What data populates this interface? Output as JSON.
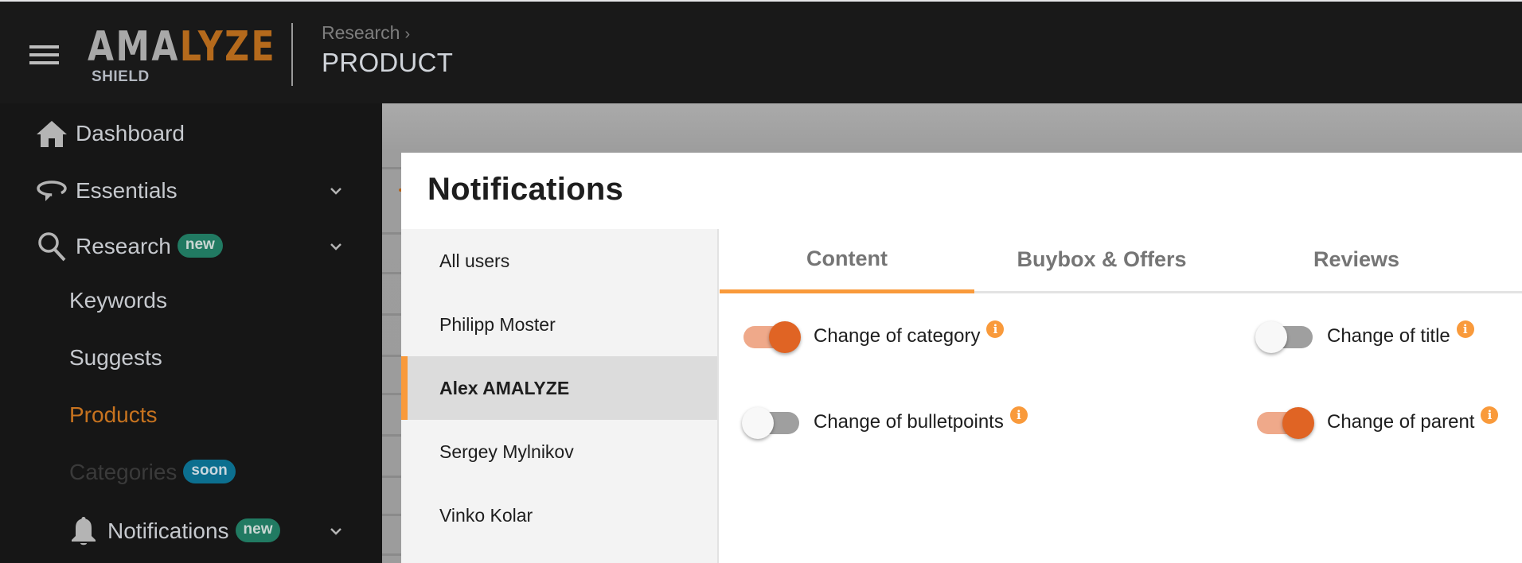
{
  "header": {
    "logo_primary": "AMA",
    "logo_accent": "LYZE",
    "logo_sub": "SHIELD",
    "breadcrumb_parent": "Research",
    "breadcrumb_sep": "›",
    "page_title": "PRODUCT"
  },
  "sidebar": {
    "items": [
      {
        "label": "Dashboard",
        "icon": "home-icon"
      },
      {
        "label": "Essentials",
        "icon": "loop-icon",
        "expandable": true
      },
      {
        "label": "Research",
        "icon": "search-icon",
        "badge": "new",
        "expandable": true
      },
      {
        "label": "Keywords"
      },
      {
        "label": "Suggests"
      },
      {
        "label": "Products",
        "active": true
      },
      {
        "label": "Categories",
        "badge": "soon",
        "disabled": true
      },
      {
        "label": "Notifications",
        "icon": "bell-icon",
        "badge": "new",
        "expandable": true
      }
    ]
  },
  "modal": {
    "title": "Notifications",
    "users": [
      {
        "name": "All users"
      },
      {
        "name": "Philipp Moster"
      },
      {
        "name": "Alex AMALYZE",
        "selected": true
      },
      {
        "name": "Sergey Mylnikov"
      },
      {
        "name": "Vinko Kolar"
      }
    ],
    "tabs": [
      {
        "label": "Content",
        "active": true
      },
      {
        "label": "Buybox & Offers"
      },
      {
        "label": "Reviews"
      }
    ],
    "settings": [
      {
        "label": "Change of category",
        "enabled": true
      },
      {
        "label": "Change of title",
        "enabled": false
      },
      {
        "label": "Change of bulletpoints",
        "enabled": false
      },
      {
        "label": "Change of parent",
        "enabled": true
      }
    ],
    "info_glyph": "i"
  },
  "colors": {
    "accent_orange": "#f99a3b",
    "brand_orange": "#b56a1c",
    "toggle_on": "#e06424",
    "badge_new": "#217a62",
    "badge_soon": "#0c6f8f"
  }
}
